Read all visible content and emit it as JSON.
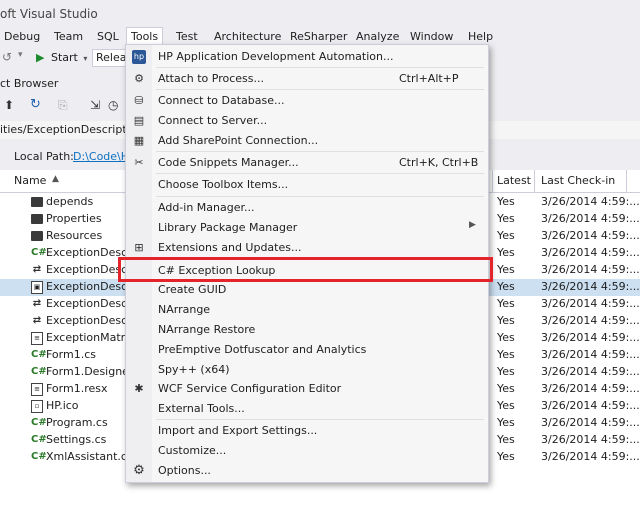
{
  "window": {
    "title": "oft Visual Studio"
  },
  "menubar": [
    "Debug",
    "Team",
    "SQL",
    "Tools",
    "Test",
    "Architecture",
    "ReSharper",
    "Analyze",
    "Window",
    "Help"
  ],
  "toolbar": {
    "start_label": "Start",
    "config_value": "Releas"
  },
  "solution_explorer": {
    "title": "ct Browser",
    "path": "ities/ExceptionDescriptionI",
    "local_path_label": "Local Path:",
    "local_path_value": "D:\\Code\\H",
    "columns": {
      "name": "Name",
      "latest": "Latest",
      "last_checkin": "Last Check-in"
    },
    "rows": [
      {
        "name": "depends",
        "icon": "folder-icon",
        "latest": "Yes",
        "date": "3/26/2014 4:59:..."
      },
      {
        "name": "Properties",
        "icon": "folder-icon",
        "latest": "Yes",
        "date": "3/26/2014 4:59:..."
      },
      {
        "name": "Resources",
        "icon": "folder-icon",
        "latest": "Yes",
        "date": "3/26/2014 4:59:..."
      },
      {
        "name": "ExceptionDescri",
        "icon": "cs-file-icon",
        "latest": "Yes",
        "date": "3/26/2014 4:59:..."
      },
      {
        "name": "ExceptionDescri",
        "icon": "link-icon",
        "latest": "Yes",
        "date": "3/26/2014 4:59:..."
      },
      {
        "name": "ExceptionDescrip",
        "icon": "project-file-icon",
        "latest": "Yes",
        "date": "3/26/2014 4:59:..."
      },
      {
        "name": "ExceptionDescrip",
        "icon": "link-icon",
        "latest": "Yes",
        "date": "3/26/2014 4:59:..."
      },
      {
        "name": "ExceptionDescrip",
        "icon": "link-icon",
        "latest": "Yes",
        "date": "3/26/2014 4:59:..."
      },
      {
        "name": "ExceptionMatrix.",
        "icon": "file-icon",
        "latest": "Yes",
        "date": "3/26/2014 4:59:..."
      },
      {
        "name": "Form1.cs",
        "icon": "cs-file-icon",
        "latest": "Yes",
        "date": "3/26/2014 4:59:..."
      },
      {
        "name": "Form1.Designer.",
        "icon": "cs-file-icon",
        "latest": "Yes",
        "date": "3/26/2014 4:59:..."
      },
      {
        "name": "Form1.resx",
        "icon": "file-icon",
        "latest": "Yes",
        "date": "3/26/2014 4:59:..."
      },
      {
        "name": "HP.ico",
        "icon": "file-icon",
        "latest": "Yes",
        "date": "3/26/2014 4:59:..."
      },
      {
        "name": "Program.cs",
        "icon": "cs-file-icon",
        "latest": "Yes",
        "date": "3/26/2014 4:59:..."
      },
      {
        "name": "Settings.cs",
        "icon": "cs-file-icon",
        "latest": "Yes",
        "date": "3/26/2014 4:59:..."
      },
      {
        "name": "XmlAssistant.cs",
        "icon": "cs-file-icon",
        "latest": "Yes",
        "date": "3/26/2014 4:59:..."
      }
    ]
  },
  "tools_menu": {
    "items": [
      {
        "label": "HP Application Development Automation...",
        "shortcut": "",
        "icon": "hp-icon"
      },
      {
        "label": "Attach to Process...",
        "shortcut": "Ctrl+Alt+P",
        "icon": "attach-icon"
      },
      {
        "label": "Connect to Database...",
        "shortcut": "",
        "icon": "database-icon"
      },
      {
        "label": "Connect to Server...",
        "shortcut": "",
        "icon": "server-icon"
      },
      {
        "label": "Add SharePoint Connection...",
        "shortcut": "",
        "icon": "sharepoint-icon"
      },
      {
        "label": "Code Snippets Manager...",
        "shortcut": "Ctrl+K, Ctrl+B",
        "icon": "snippets-icon"
      },
      {
        "label": "Choose Toolbox Items...",
        "shortcut": "",
        "icon": ""
      },
      {
        "label": "Add-in Manager...",
        "shortcut": "",
        "icon": ""
      },
      {
        "label": "Library Package Manager",
        "shortcut": "",
        "icon": ""
      },
      {
        "label": "Extensions and Updates...",
        "shortcut": "",
        "icon": "extensions-icon"
      },
      {
        "label": "C# Exception Lookup",
        "shortcut": "",
        "icon": ""
      },
      {
        "label": "Create GUID",
        "shortcut": "",
        "icon": ""
      },
      {
        "label": "NArrange",
        "shortcut": "",
        "icon": ""
      },
      {
        "label": "NArrange Restore",
        "shortcut": "",
        "icon": ""
      },
      {
        "label": "PreEmptive Dotfuscator and Analytics",
        "shortcut": "",
        "icon": ""
      },
      {
        "label": "Spy++ (x64)",
        "shortcut": "",
        "icon": ""
      },
      {
        "label": "WCF Service Configuration Editor",
        "shortcut": "",
        "icon": "wcf-icon"
      },
      {
        "label": "External Tools...",
        "shortcut": "",
        "icon": ""
      },
      {
        "label": "Import and Export Settings...",
        "shortcut": "",
        "icon": ""
      },
      {
        "label": "Customize...",
        "shortcut": "",
        "icon": ""
      },
      {
        "label": "Options...",
        "shortcut": "",
        "icon": "gear-icon"
      }
    ]
  },
  "colors": {
    "highlight_box": "#e3242b",
    "link": "#0e70c0",
    "selected_row": "#cce0f1"
  }
}
